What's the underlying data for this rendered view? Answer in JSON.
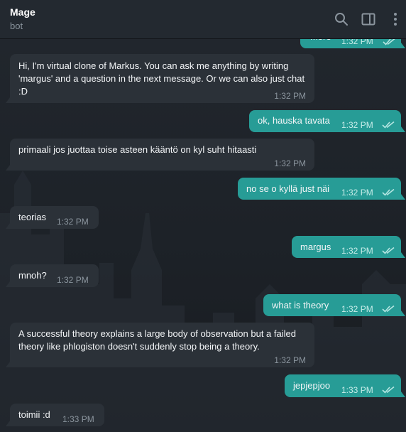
{
  "header": {
    "title": "Mage",
    "subtitle": "bot",
    "icons": [
      "search-icon",
      "sidebar-toggle-icon",
      "more-vertical-icon"
    ]
  },
  "colors": {
    "incoming_bubble": "#2b3138",
    "outgoing_bubble": "#279c96",
    "header_bg": "#232930"
  },
  "messages": [
    {
      "direction": "out",
      "text": "More",
      "time": "1:32 PM",
      "status": "read"
    },
    {
      "direction": "in",
      "text": "Hi, I'm virtual clone of Markus. You can ask me anything by writing 'margus' and a question in the next message. Or we can also just chat :D",
      "time": "1:32 PM"
    },
    {
      "direction": "out",
      "text": "ok, hauska tavata",
      "time": "1:32 PM",
      "status": "read"
    },
    {
      "direction": "in",
      "text": "primaali jos juottaa toise asteen kääntö on kyl suht hitaasti",
      "time": "1:32 PM"
    },
    {
      "direction": "out",
      "text": "no se o kyllä just näi",
      "time": "1:32 PM",
      "status": "read"
    },
    {
      "direction": "in",
      "text": "teorias",
      "time": "1:32 PM"
    },
    {
      "direction": "out",
      "text": "margus",
      "time": "1:32 PM",
      "status": "read"
    },
    {
      "direction": "in",
      "text": "mnoh?",
      "time": "1:32 PM"
    },
    {
      "direction": "out",
      "text": "what is theory",
      "time": "1:32 PM",
      "status": "read"
    },
    {
      "direction": "in",
      "text": "A successful theory explains a large body of observation but a failed theory like phlogiston doesn't suddenly stop being a theory.",
      "time": "1:32 PM"
    },
    {
      "direction": "out",
      "text": "jepjepjoo",
      "time": "1:33 PM",
      "status": "read"
    },
    {
      "direction": "in",
      "text": "toimii :d",
      "time": "1:33 PM"
    }
  ]
}
